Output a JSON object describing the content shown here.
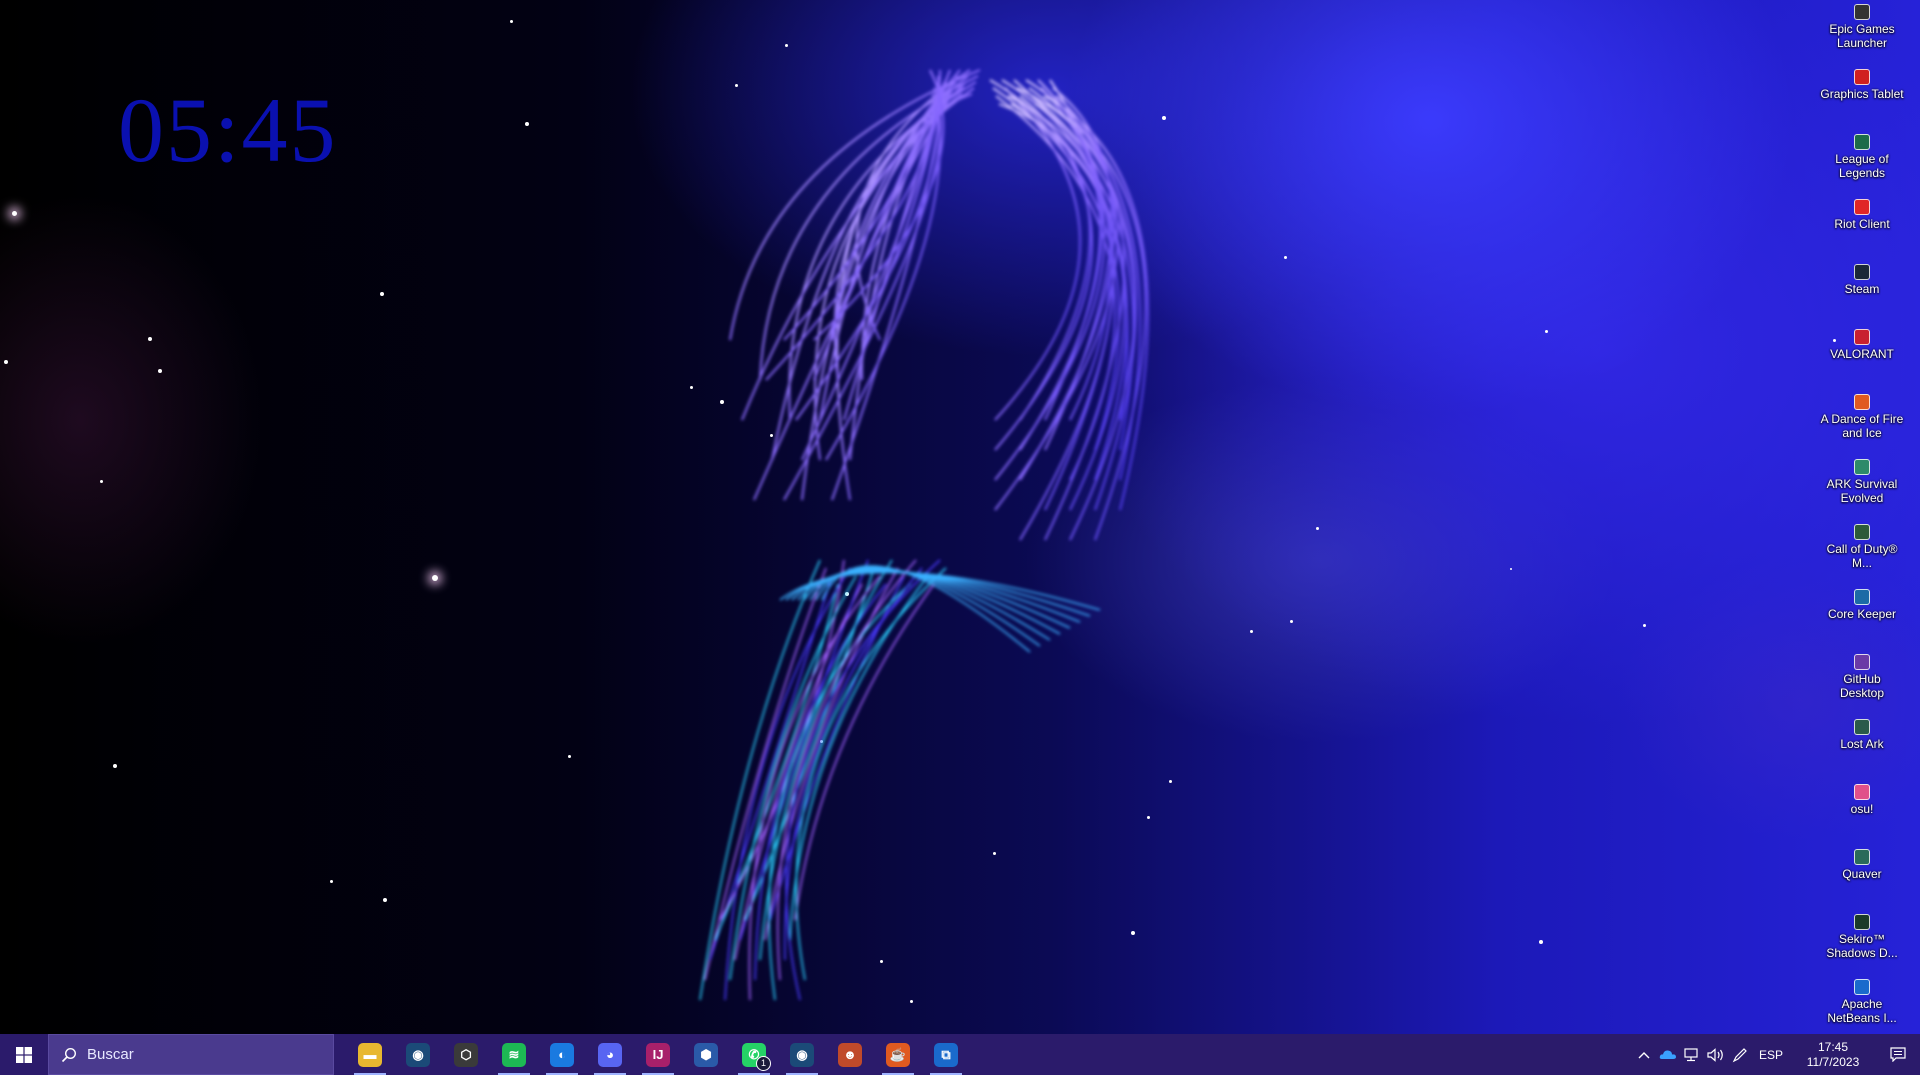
{
  "clock": {
    "time": "05:45"
  },
  "desktop_icons": [
    {
      "label": "Epic Games Launcher",
      "icon": "epic-games-icon",
      "color": "#333333"
    },
    {
      "label": "Graphics Tablet",
      "icon": "graphics-tablet-icon",
      "color": "#d02020"
    },
    {
      "label": "League of Legends",
      "icon": "league-of-legends-icon",
      "color": "#1c6b4a"
    },
    {
      "label": "Riot Client",
      "icon": "riot-client-icon",
      "color": "#e02626"
    },
    {
      "label": "Steam",
      "icon": "steam-icon",
      "color": "#1b2838"
    },
    {
      "label": "VALORANT",
      "icon": "valorant-icon",
      "color": "#c82030"
    },
    {
      "label": "A Dance of Fire and Ice",
      "icon": "dance-of-fire-and-ice-icon",
      "color": "#e05a20"
    },
    {
      "label": "ARK Survival Evolved",
      "icon": "ark-icon",
      "color": "#2e8a6a"
    },
    {
      "label": "Call of Duty® M...",
      "icon": "call-of-duty-icon",
      "color": "#2c5a3a"
    },
    {
      "label": "Core Keeper",
      "icon": "core-keeper-icon",
      "color": "#1c6aa6"
    },
    {
      "label": "GitHub Desktop",
      "icon": "github-desktop-icon",
      "color": "#6a3aa6"
    },
    {
      "label": "Lost Ark",
      "icon": "lost-ark-icon",
      "color": "#2a5a4a"
    },
    {
      "label": "osu!",
      "icon": "osu-icon",
      "color": "#e0508a"
    },
    {
      "label": "Quaver",
      "icon": "quaver-icon",
      "color": "#2a6a5a"
    },
    {
      "label": "Sekiro™ Shadows D...",
      "icon": "sekiro-icon",
      "color": "#1a3a2a"
    },
    {
      "label": "Apache NetBeans I...",
      "icon": "netbeans-icon",
      "color": "#1a6acc"
    }
  ],
  "taskbar": {
    "search_placeholder": "Buscar",
    "apps": [
      {
        "name": "file-explorer",
        "icon": "folder-icon",
        "color": "#e8b830",
        "glyph": "▬",
        "active": true
      },
      {
        "name": "steam",
        "icon": "steam-icon",
        "color": "#1b4a78",
        "glyph": "◉",
        "active": false
      },
      {
        "name": "unity-hub",
        "icon": "unity-icon",
        "color": "#3a3a3a",
        "glyph": "⬡",
        "active": false
      },
      {
        "name": "spotify",
        "icon": "spotify-icon",
        "color": "#1db954",
        "glyph": "≋",
        "active": true
      },
      {
        "name": "firefox",
        "icon": "firefox-icon",
        "color": "#1a7ae0",
        "glyph": "◐",
        "active": true
      },
      {
        "name": "discord",
        "icon": "discord-icon",
        "color": "#5865f2",
        "glyph": "◕",
        "active": true
      },
      {
        "name": "intellij-idea",
        "icon": "intellij-icon",
        "color": "#a8206a",
        "glyph": "IJ",
        "active": true
      },
      {
        "name": "virtualbox",
        "icon": "virtualbox-icon",
        "color": "#2a5aa8",
        "glyph": "⬢",
        "active": false
      },
      {
        "name": "whatsapp",
        "icon": "whatsapp-icon",
        "color": "#25d366",
        "glyph": "✆",
        "active": true,
        "badge": "1"
      },
      {
        "name": "steam-2",
        "icon": "steam-icon",
        "color": "#1b4a78",
        "glyph": "◉",
        "active": true
      },
      {
        "name": "game-app",
        "icon": "game-icon",
        "color": "#c04a2a",
        "glyph": "☻",
        "active": false
      },
      {
        "name": "java",
        "icon": "java-icon",
        "color": "#e05a20",
        "glyph": "☕",
        "active": true
      },
      {
        "name": "remote-app",
        "icon": "remote-icon",
        "color": "#1a6acc",
        "glyph": "⧉",
        "active": true
      }
    ]
  },
  "tray": {
    "language": "ESP",
    "time": "17:45",
    "date": "11/7/2023"
  }
}
